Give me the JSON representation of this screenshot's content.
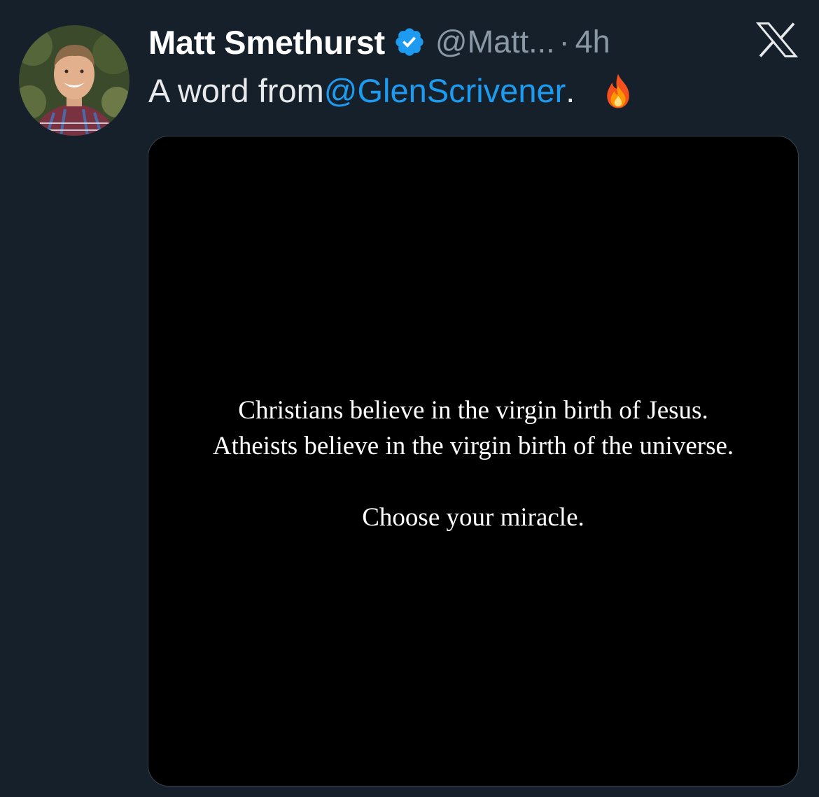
{
  "tweet": {
    "author": {
      "name": "Matt Smethurst",
      "handle": "@Matt...",
      "verified": true,
      "avatar": "avatar-photo"
    },
    "separator": "·",
    "time": "4h",
    "text": {
      "prefix": "A word from ",
      "mention": "@GlenScrivener",
      "suffix": ".",
      "emoji": "fire-icon"
    },
    "media": {
      "lines": [
        "Christians believe in the virgin birth of Jesus.",
        "Atheists believe in the virgin birth of the universe.",
        "Choose your miracle."
      ]
    }
  },
  "icons": {
    "verified": "verified-badge-icon",
    "platform": "x-logo-icon"
  },
  "colors": {
    "background": "#15202b",
    "link": "#1d9bf0",
    "muted": "#8b98a5",
    "media_background": "#000000"
  }
}
